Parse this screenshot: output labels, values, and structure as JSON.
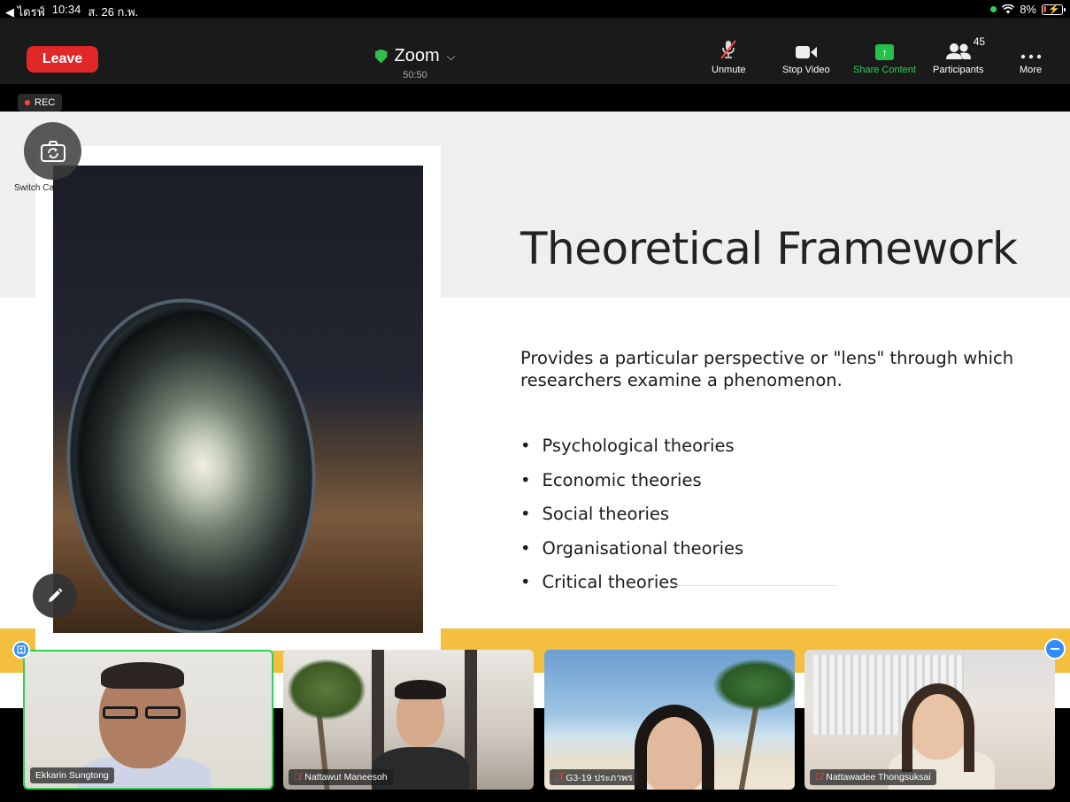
{
  "status_bar": {
    "carrier": "◀ ไดรฟ์",
    "time": "10:34",
    "date": "ส. 26 ก.พ.",
    "battery": "8%"
  },
  "toolbar": {
    "leave_label": "Leave",
    "meeting_title": "Zoom",
    "timer": "50:50",
    "unmute_label": "Unmute",
    "stop_video_label": "Stop Video",
    "share_label": "Share Content",
    "participants_label": "Participants",
    "participants_count": "45",
    "more_label": "More"
  },
  "recording": {
    "label": "REC"
  },
  "switch_camera": {
    "label": "Switch Camera"
  },
  "slide": {
    "title": "Theoretical Framework",
    "description": "Provides a particular perspective or \"lens\" through which researchers examine a phenomenon.",
    "bullets": [
      "Psychological theories",
      "Economic theories",
      "Social theories",
      "Organisational theories",
      "Critical theories"
    ]
  },
  "participants": [
    {
      "name": "Ekkarin Sungtong",
      "muted": false,
      "active_speaker": true
    },
    {
      "name": "Nattawut Maneesoh",
      "muted": true,
      "active_speaker": false
    },
    {
      "name": "G3-19 ประภาพร",
      "muted": true,
      "active_speaker": false
    },
    {
      "name": "Nattawadee Thongsuksai",
      "muted": true,
      "active_speaker": false
    }
  ],
  "colors": {
    "leave_red": "#e02828",
    "share_green": "#23c04a",
    "active_border": "#2fd158",
    "slide_accent": "#f4be3f",
    "zoom_blue": "#2d8cff"
  },
  "icons": {
    "mic": "mic-off-icon",
    "video": "video-camera-icon",
    "share": "share-up-arrow-icon",
    "participants": "people-icon",
    "more": "ellipsis-icon",
    "switch_camera": "camera-rotate-icon",
    "annotate": "pencil-icon"
  }
}
